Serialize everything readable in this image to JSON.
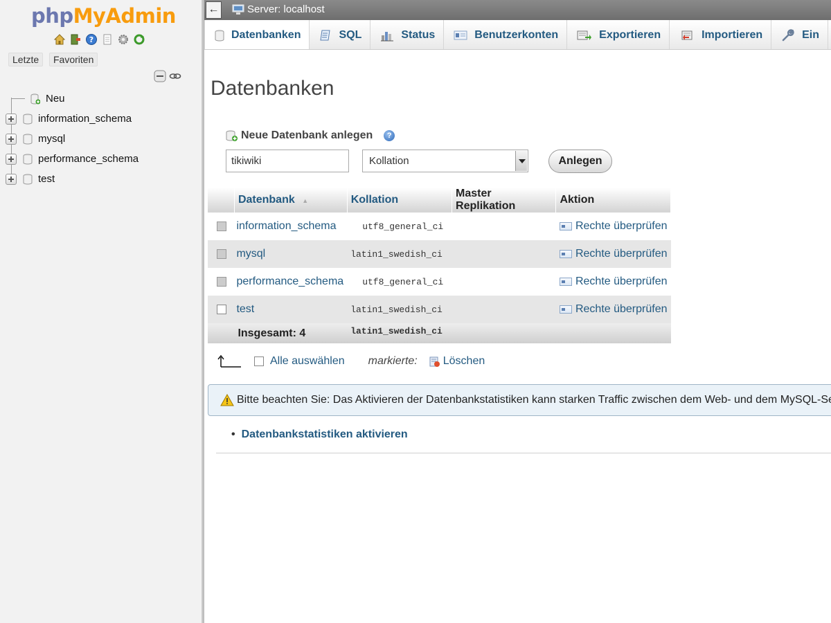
{
  "app": {
    "logo_php": "php",
    "logo_myadmin": "MyAdmin"
  },
  "sidebar": {
    "recent_label": "Letzte",
    "favorites_label": "Favoriten",
    "tree": [
      {
        "label": "Neu",
        "type": "new"
      },
      {
        "label": "information_schema",
        "type": "db"
      },
      {
        "label": "mysql",
        "type": "db"
      },
      {
        "label": "performance_schema",
        "type": "db"
      },
      {
        "label": "test",
        "type": "db"
      }
    ]
  },
  "topbar": {
    "back_label": "←",
    "server_label": "Server: localhost"
  },
  "tabs": [
    {
      "label": "Datenbanken",
      "icon": "database-icon",
      "active": true
    },
    {
      "label": "SQL",
      "icon": "sql-icon"
    },
    {
      "label": "Status",
      "icon": "status-icon"
    },
    {
      "label": "Benutzerkonten",
      "icon": "users-icon"
    },
    {
      "label": "Exportieren",
      "icon": "export-icon"
    },
    {
      "label": "Importieren",
      "icon": "import-icon"
    },
    {
      "label": "Ein",
      "icon": "wrench-icon"
    }
  ],
  "main": {
    "title": "Datenbanken",
    "new_db": {
      "heading": "Neue Datenbank anlegen",
      "name_value": "tikiwiki",
      "collation_value": "Kollation",
      "create_button": "Anlegen"
    },
    "table": {
      "headers": {
        "name": "Datenbank",
        "sort_indicator": "▲",
        "collation": "Kollation",
        "master": "Master Replikation",
        "action": "Aktion"
      },
      "rows": [
        {
          "name": "information_schema",
          "collation": "utf8_general_ci",
          "action": "Rechte überprüfen",
          "checkbox_disabled": true
        },
        {
          "name": "mysql",
          "collation": "latin1_swedish_ci",
          "action": "Rechte überprüfen",
          "checkbox_disabled": true
        },
        {
          "name": "performance_schema",
          "collation": "utf8_general_ci",
          "action": "Rechte überprüfen",
          "checkbox_disabled": true
        },
        {
          "name": "test",
          "collation": "latin1_swedish_ci",
          "action": "Rechte überprüfen",
          "checkbox_disabled": false
        }
      ],
      "total_label": "Insgesamt: 4",
      "total_collation": "latin1_swedish_ci"
    },
    "bulk": {
      "select_all": "Alle auswählen",
      "marked_label": "markierte:",
      "delete_label": "Löschen"
    },
    "notice": "Bitte beachten Sie: Das Aktivieren der Datenbankstatistiken kann starken Traffic zwischen dem Web- und dem MySQL-Se",
    "stats_link": "Datenbankstatistiken aktivieren"
  },
  "colors": {
    "link": "#235a81",
    "logo_php": "#6c78af",
    "logo_myadmin": "#f89c0e",
    "topbar": "#7a7a7a"
  }
}
